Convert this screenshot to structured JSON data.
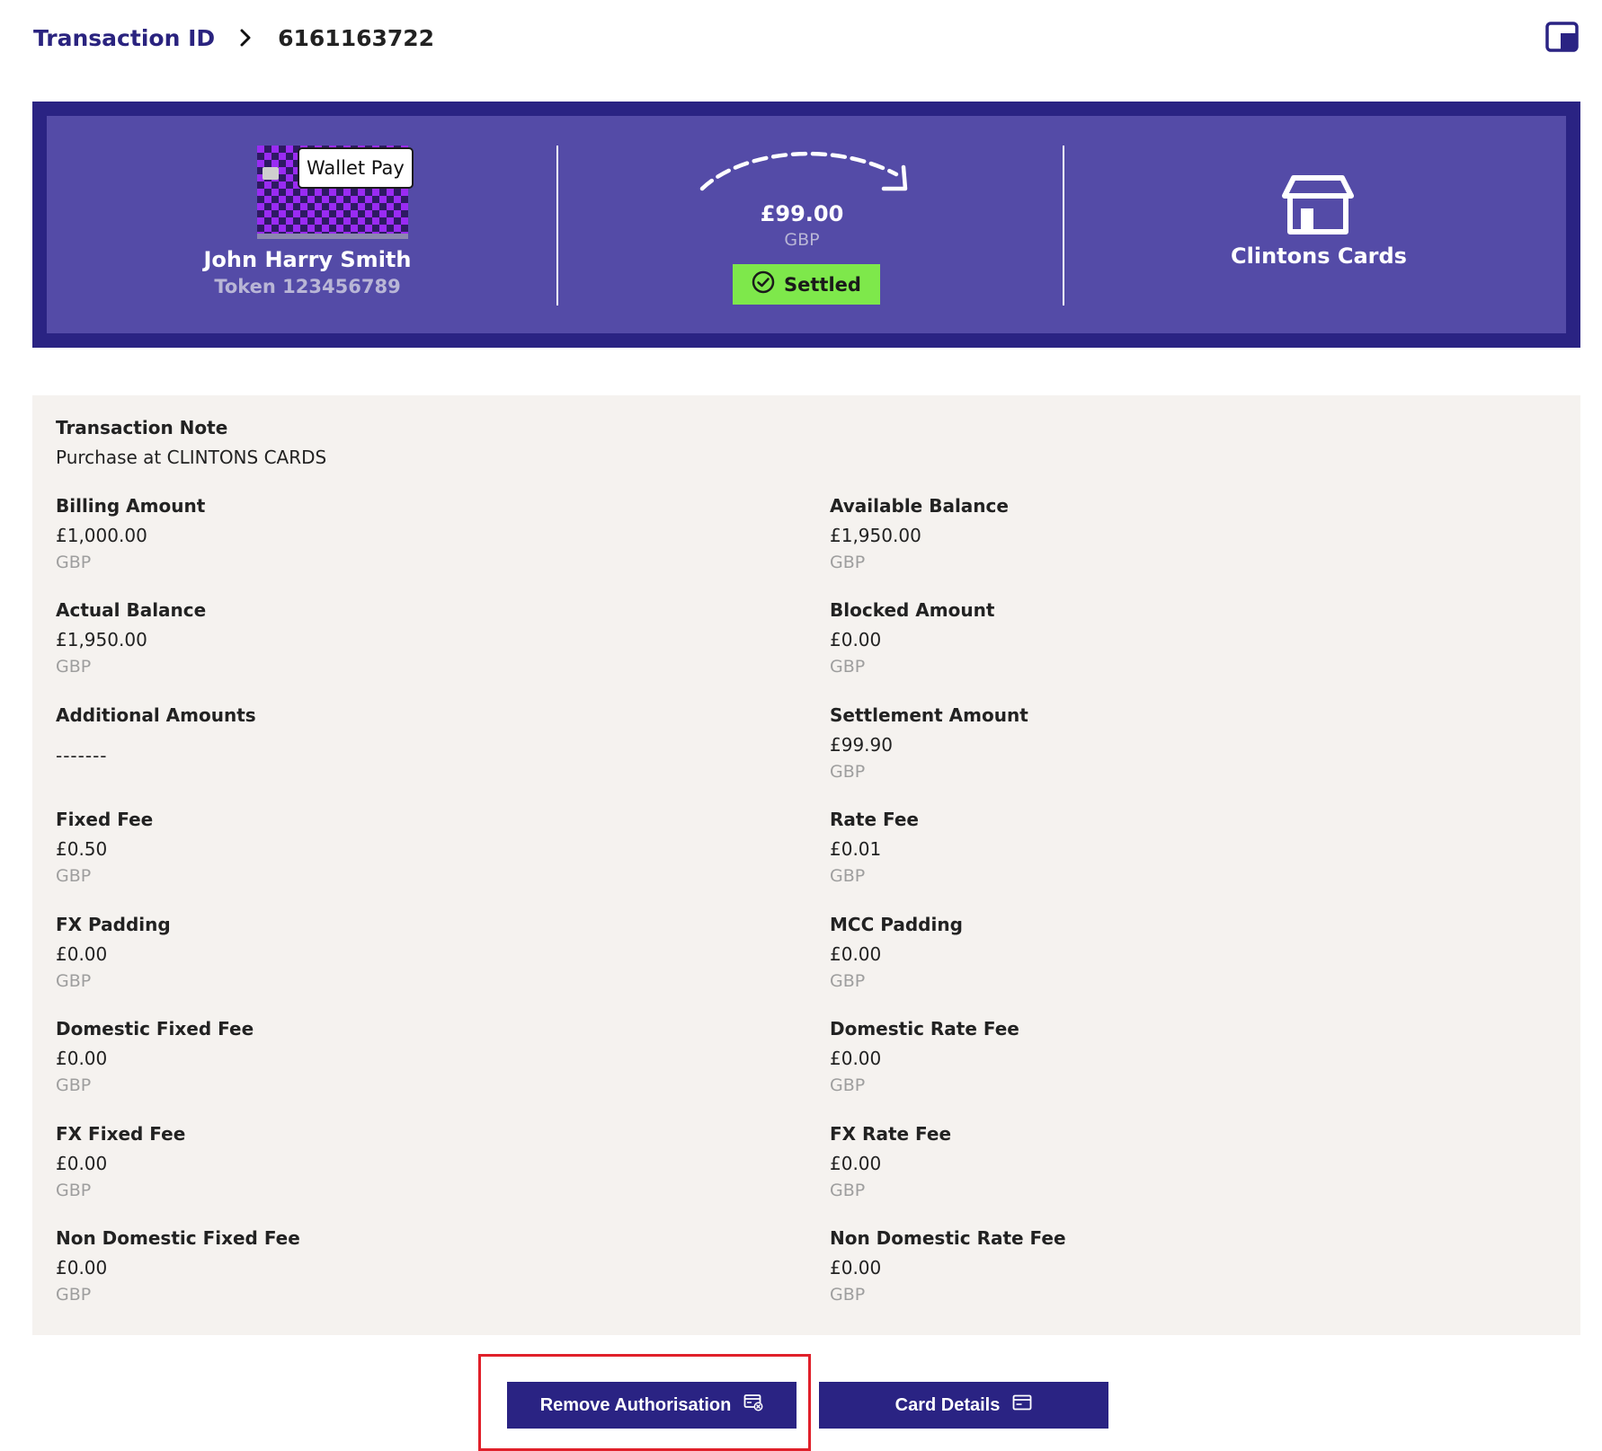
{
  "breadcrumb": {
    "parent": "Transaction ID",
    "current": "6161163722"
  },
  "summary": {
    "payment_method": "Wallet Pay",
    "cardholder_name": "John Harry Smith",
    "token": "Token 123456789",
    "amount": "£99.00",
    "currency": "GBP",
    "status": "Settled",
    "merchant": "Clintons Cards"
  },
  "details": {
    "transaction_note_label": "Transaction Note",
    "transaction_note_value": "Purchase at CLINTONS CARDS",
    "fields": [
      {
        "label": "Billing Amount",
        "value": "£1,000.00",
        "currency": "GBP"
      },
      {
        "label": "Available Balance",
        "value": "£1,950.00",
        "currency": "GBP"
      },
      {
        "label": "Actual Balance",
        "value": "£1,950.00",
        "currency": "GBP"
      },
      {
        "label": "Blocked Amount",
        "value": "£0.00",
        "currency": "GBP"
      },
      {
        "label": "Additional Amounts",
        "value": "-------"
      },
      {
        "label": "Settlement Amount",
        "value": "£99.90",
        "currency": "GBP"
      },
      {
        "label": "Fixed Fee",
        "value": "£0.50",
        "currency": "GBP"
      },
      {
        "label": "Rate Fee",
        "value": "£0.01",
        "currency": "GBP"
      },
      {
        "label": "FX Padding",
        "value": "£0.00",
        "currency": "GBP"
      },
      {
        "label": "MCC Padding",
        "value": "£0.00",
        "currency": "GBP"
      },
      {
        "label": "Domestic Fixed Fee",
        "value": "£0.00",
        "currency": "GBP"
      },
      {
        "label": "Domestic Rate Fee",
        "value": "£0.00",
        "currency": "GBP"
      },
      {
        "label": "FX Fixed Fee",
        "value": "£0.00",
        "currency": "GBP"
      },
      {
        "label": "FX Rate Fee",
        "value": "£0.00",
        "currency": "GBP"
      },
      {
        "label": "Non Domestic Fixed Fee",
        "value": "£0.00",
        "currency": "GBP"
      },
      {
        "label": "Non Domestic Rate Fee",
        "value": "£0.00",
        "currency": "GBP"
      }
    ]
  },
  "actions": {
    "remove_authorisation": "Remove Authorisation",
    "card_details": "Card Details"
  },
  "icons": {
    "breadcrumb_separator": "chevron-right-icon",
    "window": "window-icon",
    "transfer": "dashed-arrow-icon",
    "status": "check-circle-icon",
    "merchant": "store-icon",
    "remove_authorisation": "card-remove-icon",
    "card_details": "credit-card-icon"
  },
  "colors": {
    "brand_dark": "#2a2383",
    "banner_inner": "#544ba7",
    "status_settled": "#7ee84b",
    "panel_background": "#f5f2ef",
    "highlight": "#e0202a"
  }
}
